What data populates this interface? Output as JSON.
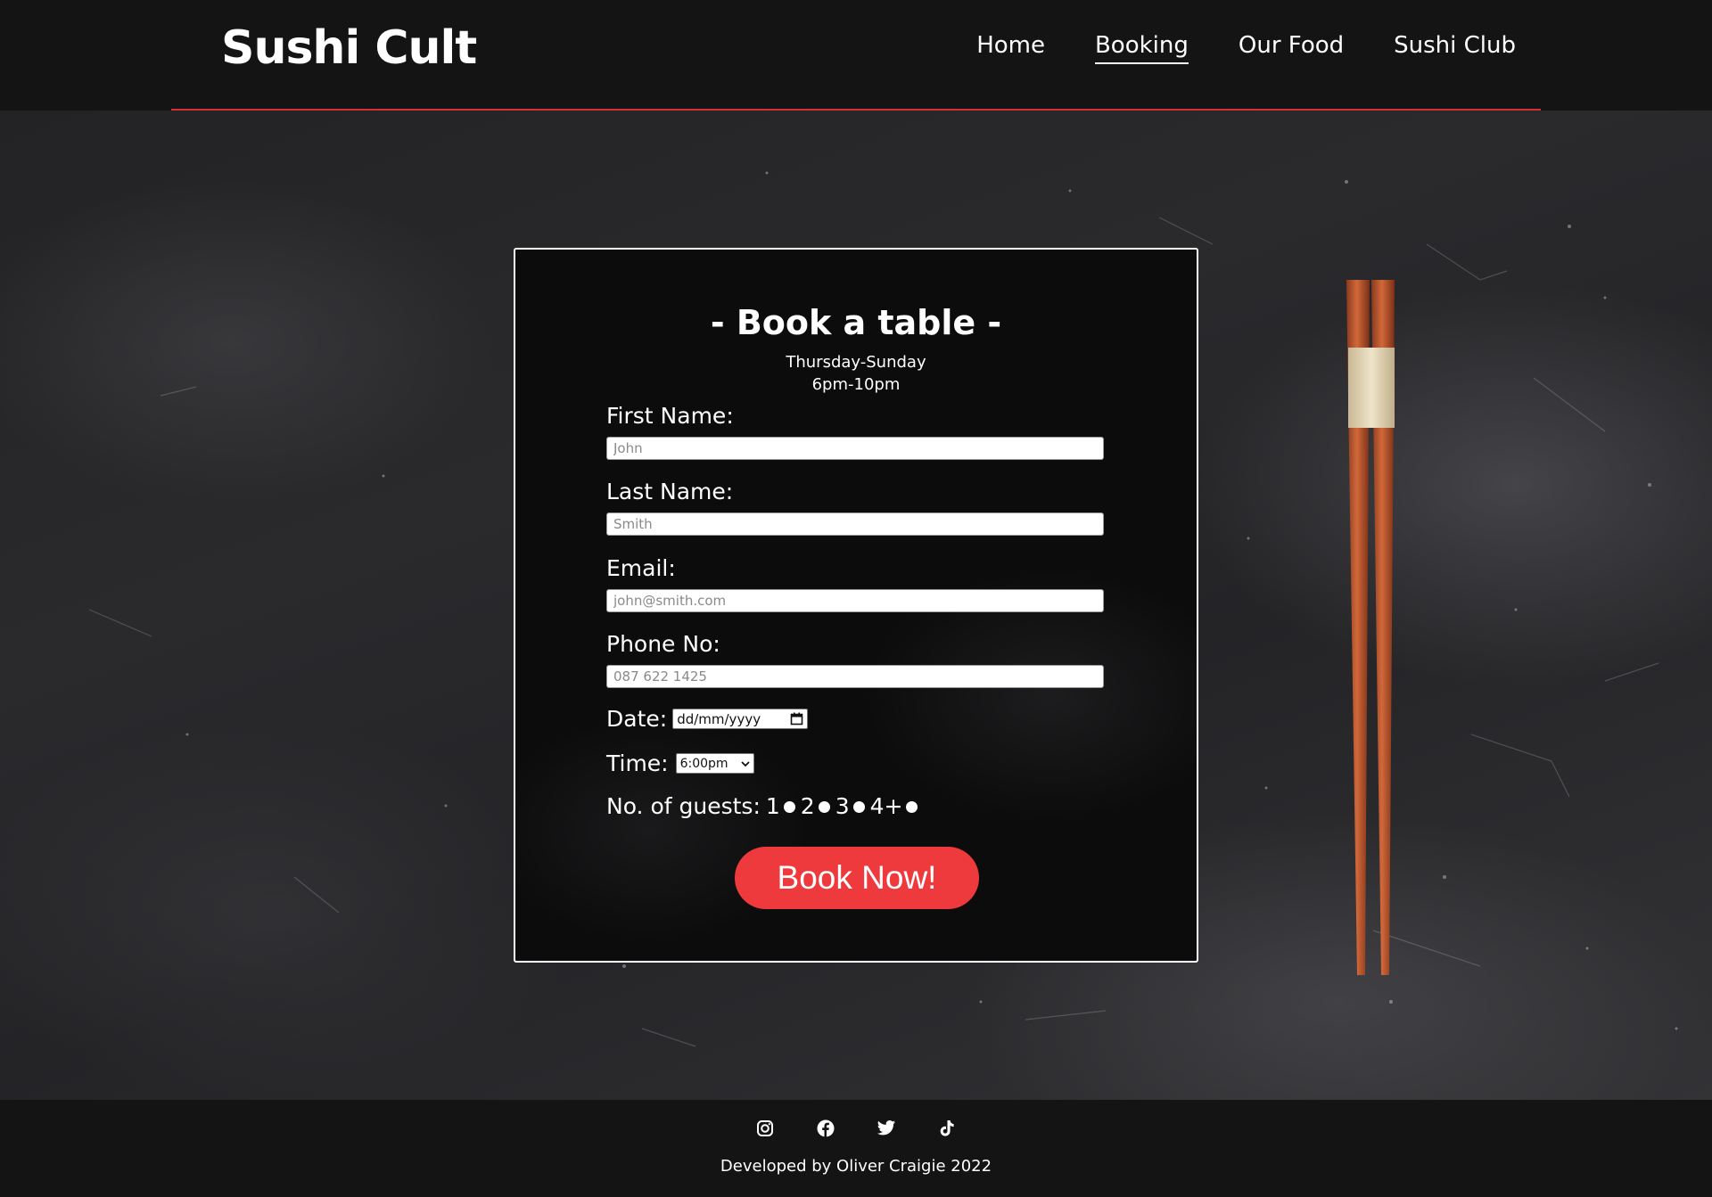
{
  "header": {
    "brand": "Sushi Cult",
    "nav": [
      {
        "label": "Home",
        "active": false
      },
      {
        "label": "Booking",
        "active": true
      },
      {
        "label": "Our Food",
        "active": false
      },
      {
        "label": "Sushi Club",
        "active": false
      }
    ]
  },
  "booking": {
    "title": "- Book a table -",
    "days": "Thursday-Sunday",
    "hours": "6pm-10pm",
    "first_name": {
      "label": "First Name:",
      "placeholder": "John"
    },
    "last_name": {
      "label": "Last Name:",
      "placeholder": "Smith"
    },
    "email": {
      "label": "Email:",
      "placeholder": "john@smith.com"
    },
    "phone": {
      "label": "Phone No:",
      "placeholder": "087 622 1425"
    },
    "date": {
      "label": "Date:",
      "placeholder": "dd/mm/yyyy"
    },
    "time": {
      "label": "Time:",
      "value": "6:00pm"
    },
    "guests": {
      "label": "No. of guests:",
      "options": [
        "1",
        "2",
        "3",
        "4+"
      ]
    },
    "submit_label": "Book Now!"
  },
  "footer": {
    "socials": [
      "instagram-icon",
      "facebook-icon",
      "twitter-icon",
      "tiktok-icon"
    ],
    "credit": "Developed by Oliver Craigie 2022"
  },
  "colors": {
    "accent": "#ee3a3d",
    "header_bg": "#141414",
    "divider": "#d4303a"
  }
}
